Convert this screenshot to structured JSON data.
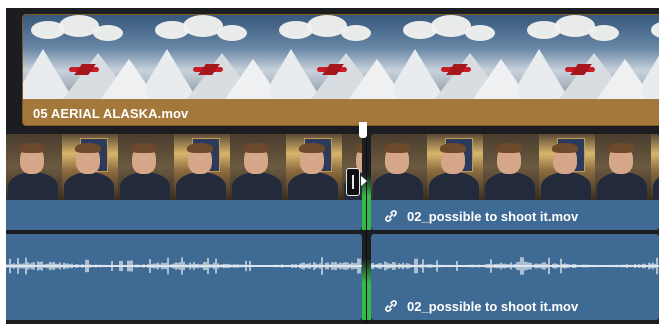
{
  "timeline": {
    "aerial_clip": {
      "name": "05 AERIAL  ALASKA.mov",
      "color": "#a3783a"
    },
    "video_clip_right": {
      "name": "02_possible to shoot it.mov",
      "icon": "link-icon"
    },
    "audio_clip_right": {
      "name": "02_possible to shoot it.mov",
      "icon": "link-icon"
    },
    "clip_color": "#3f6a94",
    "edit_point_color": "#36b94b",
    "edit_tool": "trim-cursor-icon"
  }
}
